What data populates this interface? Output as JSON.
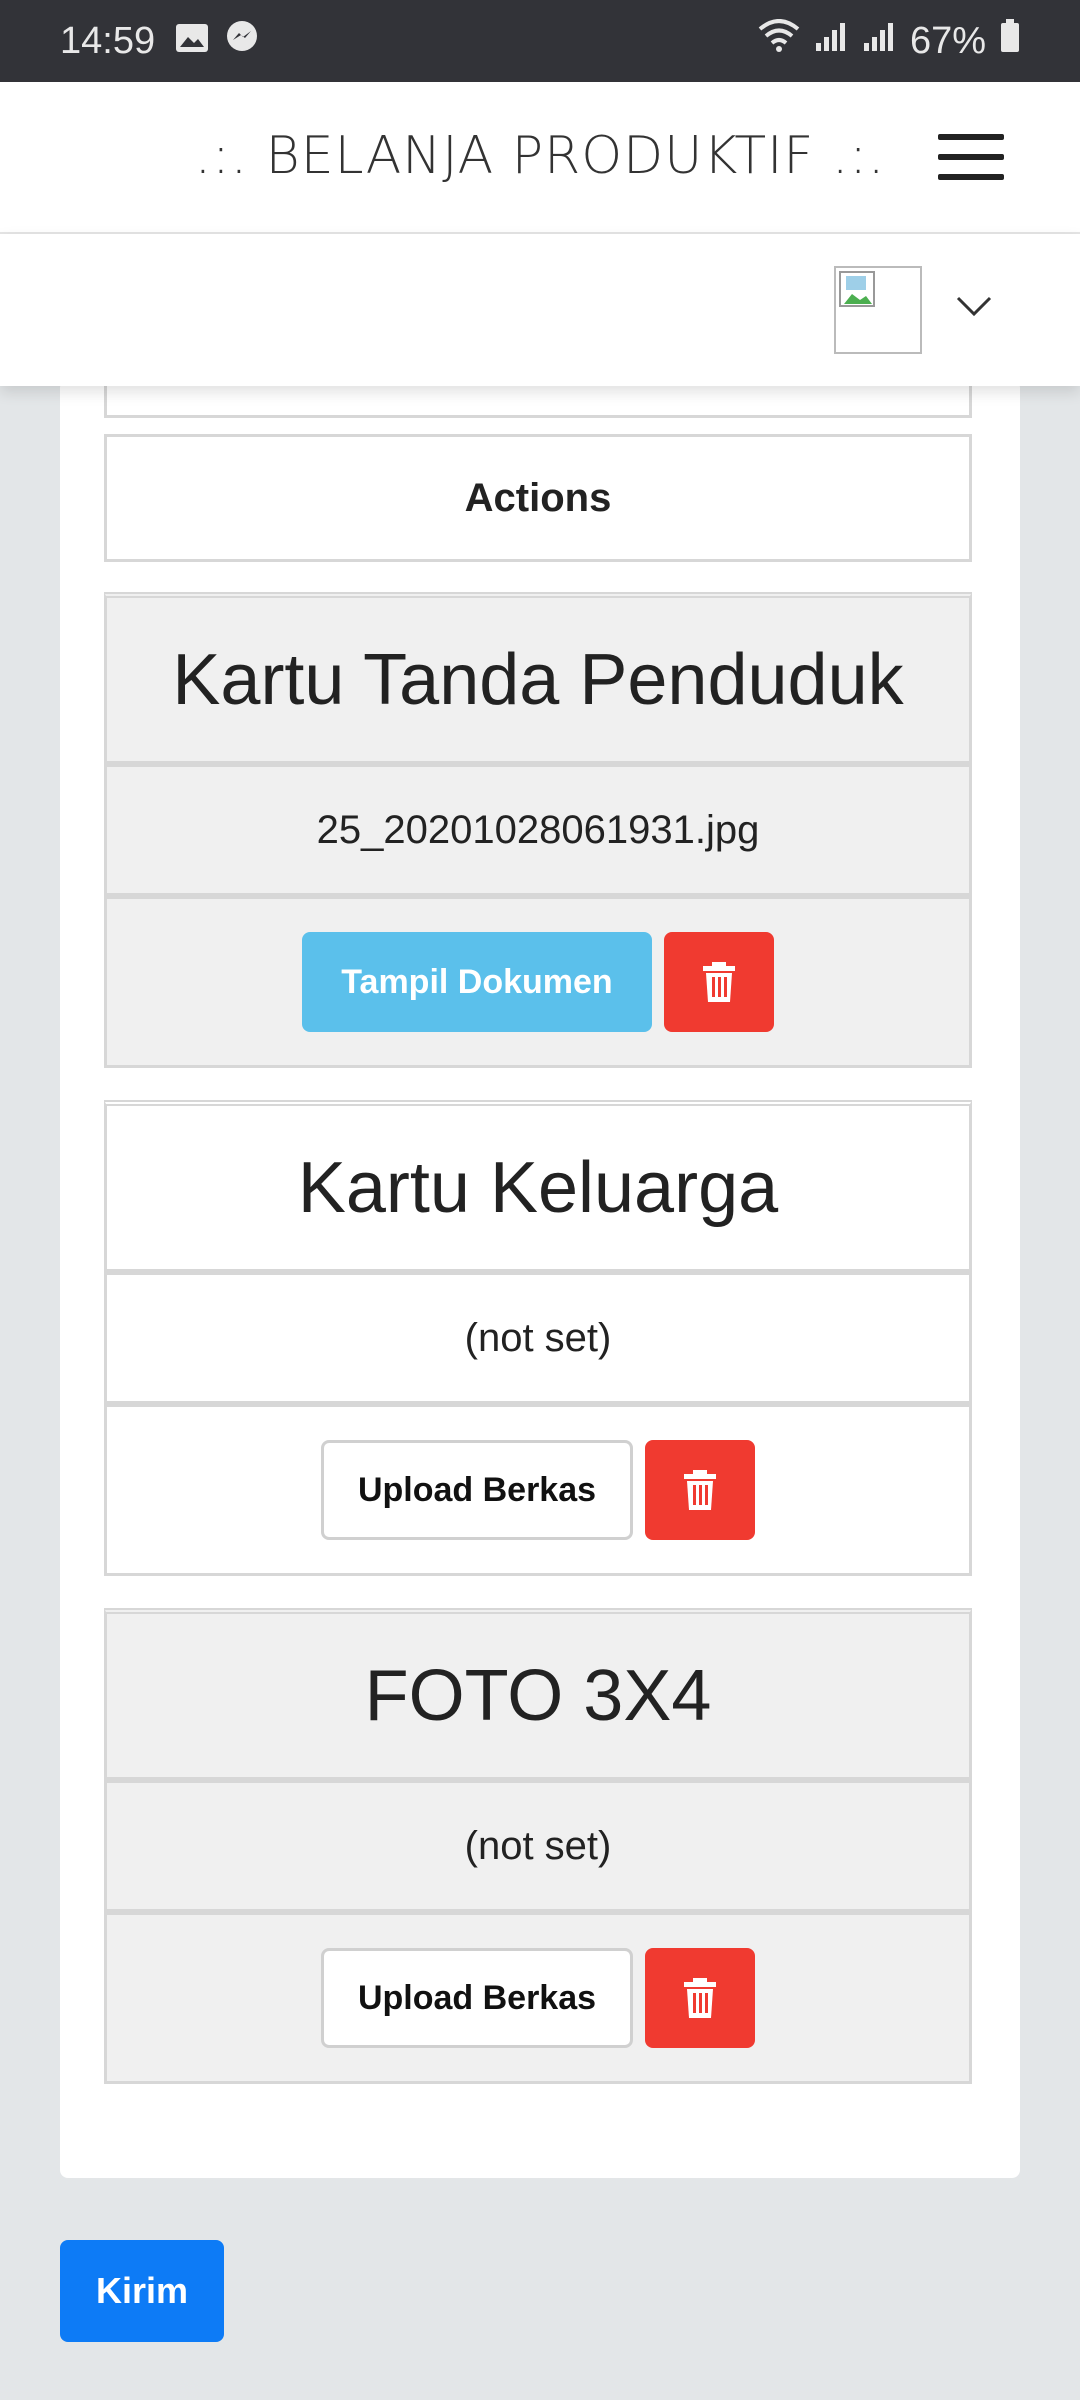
{
  "status_bar": {
    "time": "14:59",
    "battery": "67%",
    "icons": [
      "image-icon",
      "messenger-icon",
      "wifi-icon",
      "signal-icon",
      "signal-icon",
      "battery-icon"
    ]
  },
  "header": {
    "brand": ".:. BELANJA PRODUKTIF .:."
  },
  "table": {
    "actions_header": "Actions",
    "documents": [
      {
        "name": "Kartu Tanda Penduduk",
        "file": "25_20201028061931.jpg",
        "primary_button": "Tampil Dokumen"
      },
      {
        "name": "Kartu Keluarga",
        "file": "(not set)",
        "primary_button": "Upload Berkas"
      },
      {
        "name": "FOTO 3X4",
        "file": "(not set)",
        "primary_button": "Upload Berkas"
      }
    ]
  },
  "submit_label": "Kirim",
  "colors": {
    "info": "#5bc0eb",
    "danger": "#f03a30",
    "primary": "#0d7bf6"
  }
}
